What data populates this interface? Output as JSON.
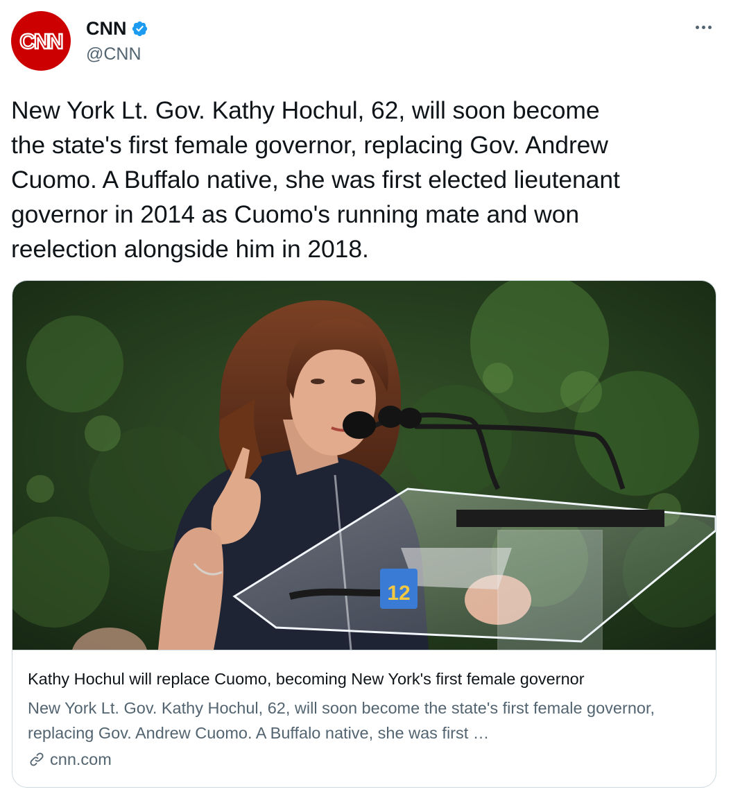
{
  "author": {
    "display_name": "CNN",
    "handle": "@CNN",
    "avatar_text": "CNN",
    "verified": true,
    "brand_color": "#cc0000",
    "verified_color": "#1d9bf0"
  },
  "tweet": {
    "text": "New York Lt. Gov. Kathy Hochul, 62, will soon become\nthe state's first female governor, replacing Gov. Andrew\nCuomo. A Buffalo native, she was first elected lieutenant\ngovernor in 2014 as Cuomo's running mate and won\nreelection alongside him in 2018."
  },
  "card": {
    "image_icon": "news-photo",
    "podium_badge": "12",
    "title": "Kathy Hochul will replace Cuomo, becoming New York's first female governor",
    "description": "New York Lt. Gov. Kathy Hochul, 62, will soon become the state's first female governor, replacing Gov. Andrew Cuomo. A Buffalo native, she was first …",
    "domain": "cnn.com",
    "domain_icon": "link-icon"
  },
  "colors": {
    "text_primary": "#0f1419",
    "text_secondary": "#536471",
    "border": "#cfd9de"
  }
}
